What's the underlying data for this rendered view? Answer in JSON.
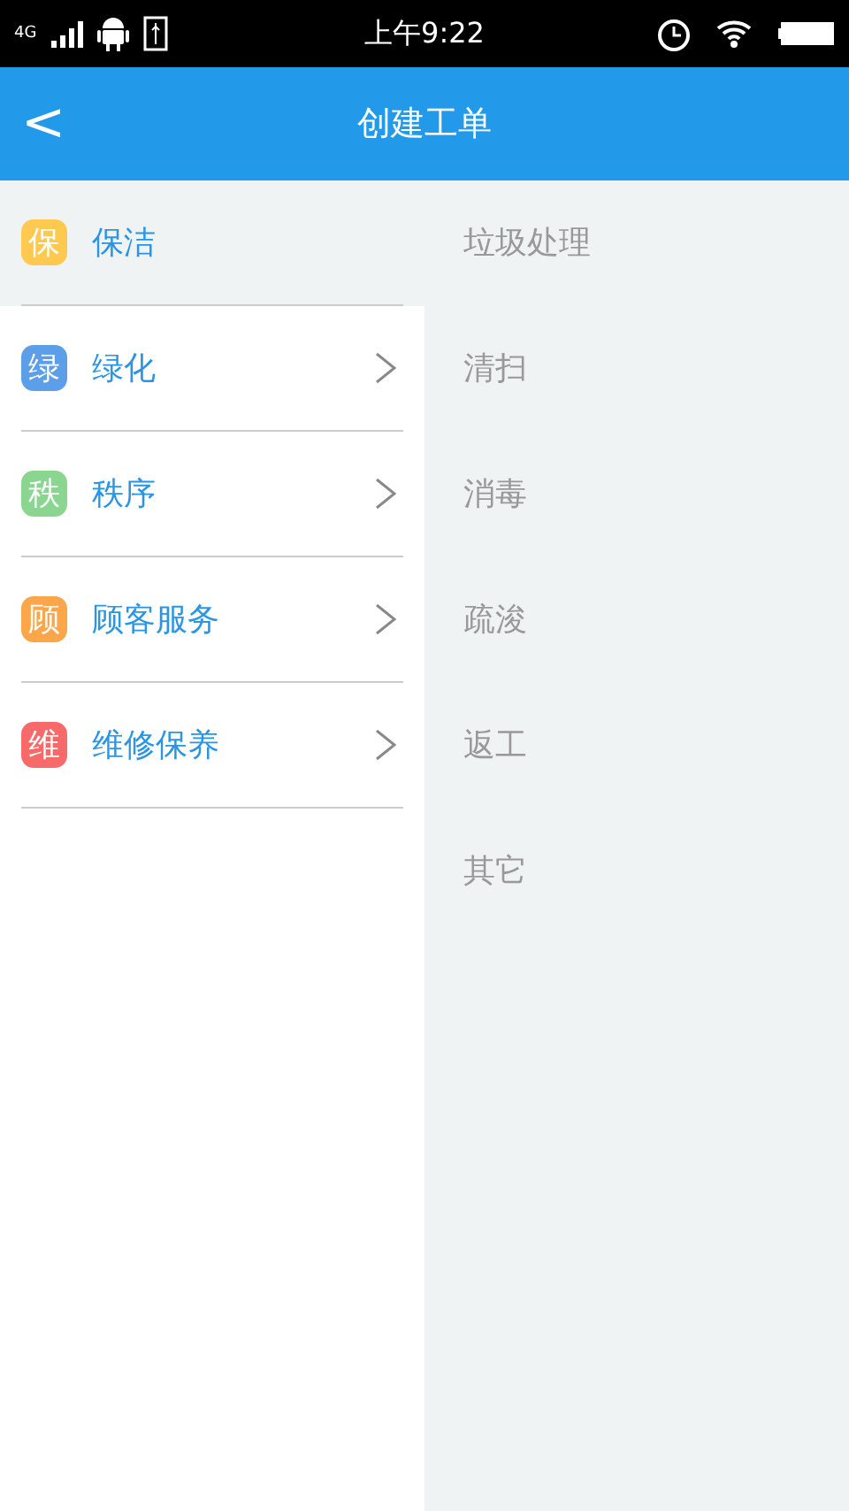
{
  "status_bar": {
    "network": "4G",
    "time": "上午9:22"
  },
  "header": {
    "back": "<",
    "title": "创建工单"
  },
  "categories": [
    {
      "badge": "保",
      "label": "保洁",
      "color": "#fdc94f",
      "selected": true
    },
    {
      "badge": "绿",
      "label": "绿化",
      "color": "#5d9ee8",
      "selected": false
    },
    {
      "badge": "秩",
      "label": "秩序",
      "color": "#8ad58f",
      "selected": false
    },
    {
      "badge": "顾",
      "label": "顾客服务",
      "color": "#fba64a",
      "selected": false
    },
    {
      "badge": "维",
      "label": "维修保养",
      "color": "#f86a6a",
      "selected": false
    }
  ],
  "subcategories": [
    "垃圾处理",
    "清扫",
    "消毒",
    "疏浚",
    "返工",
    "其它"
  ]
}
